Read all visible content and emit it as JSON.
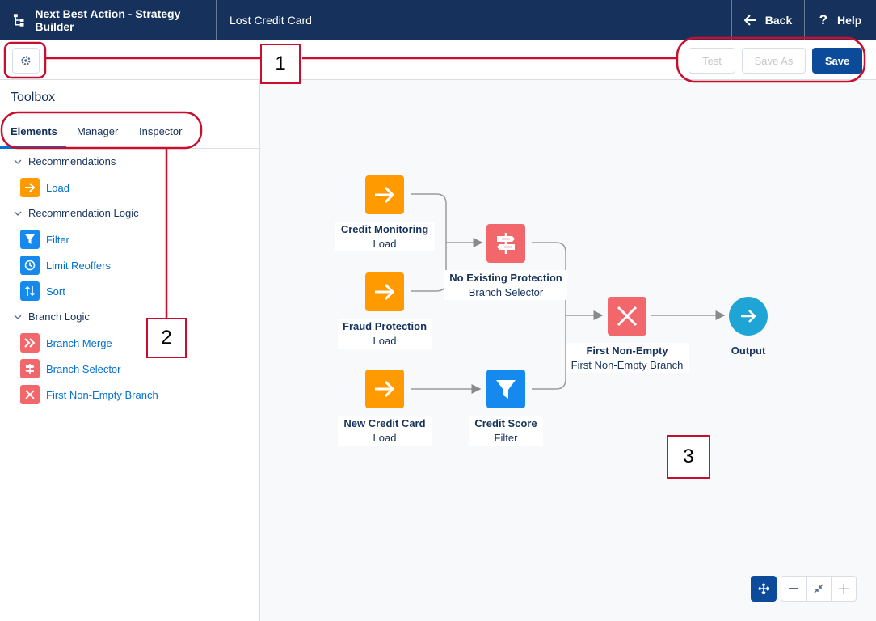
{
  "header": {
    "app_title": "Next Best Action - Strategy Builder",
    "page_title": "Lost Credit Card",
    "back_label": "Back",
    "help_label": "Help"
  },
  "toolbar": {
    "test_label": "Test",
    "save_as_label": "Save As",
    "save_label": "Save"
  },
  "toolbox": {
    "title": "Toolbox",
    "tabs": [
      "Elements",
      "Manager",
      "Inspector"
    ],
    "groups": [
      {
        "label": "Recommendations",
        "items": [
          {
            "label": "Load",
            "icon": "arrow-right-icon",
            "color": "#ff9a00"
          }
        ]
      },
      {
        "label": "Recommendation Logic",
        "items": [
          {
            "label": "Filter",
            "icon": "filter-icon",
            "color": "#1589ee"
          },
          {
            "label": "Limit Reoffers",
            "icon": "clock-icon",
            "color": "#1589ee"
          },
          {
            "label": "Sort",
            "icon": "sort-icon",
            "color": "#1589ee"
          }
        ]
      },
      {
        "label": "Branch Logic",
        "items": [
          {
            "label": "Branch Merge",
            "icon": "merge-icon",
            "color": "#f2676b"
          },
          {
            "label": "Branch Selector",
            "icon": "signpost-icon",
            "color": "#f2676b"
          },
          {
            "label": "First Non-Empty Branch",
            "icon": "x-icon",
            "color": "#f2676b"
          }
        ]
      }
    ]
  },
  "canvas": {
    "nodes": {
      "credit_monitoring": {
        "name": "Credit Monitoring",
        "type": "Load"
      },
      "fraud_protection": {
        "name": "Fraud Protection",
        "type": "Load"
      },
      "new_credit_card": {
        "name": "New Credit Card",
        "type": "Load"
      },
      "no_existing_protection": {
        "name": "No Existing Protection",
        "type": "Branch Selector"
      },
      "credit_score": {
        "name": "Credit Score",
        "type": "Filter"
      },
      "first_non_empty": {
        "name": "First Non-Empty",
        "type": "First Non-Empty Branch"
      },
      "output": {
        "name": "Output"
      }
    }
  },
  "callouts": [
    "1",
    "2",
    "3"
  ],
  "colors": {
    "header": "#16325c",
    "primary_button": "#0c4a9a",
    "load": "#ff9a00",
    "filter": "#1589ee",
    "branch": "#f2676b",
    "output": "#1ea5d6",
    "callout": "#c8102e"
  }
}
